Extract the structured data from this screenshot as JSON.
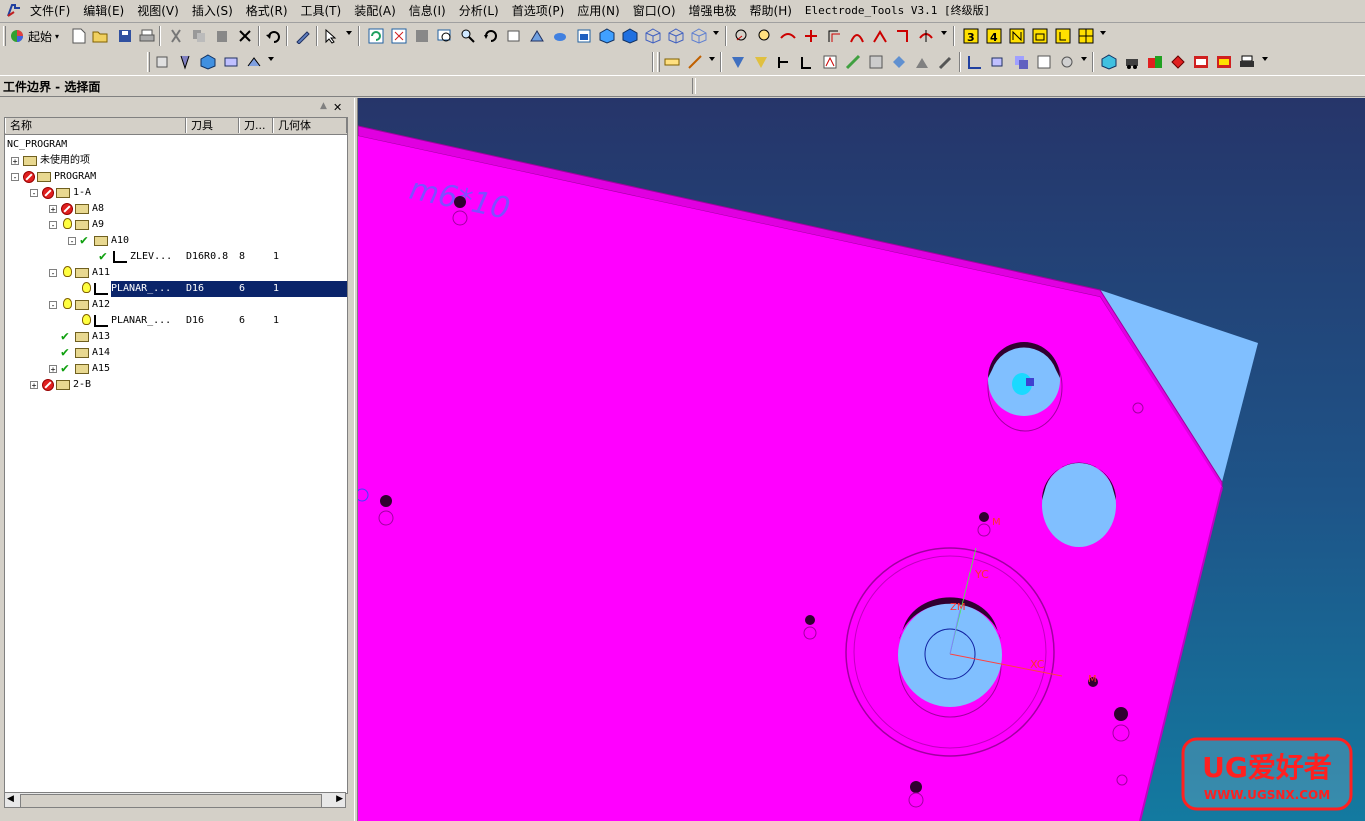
{
  "menubar": {
    "items": [
      "文件(F)",
      "编辑(E)",
      "视图(V)",
      "插入(S)",
      "格式(R)",
      "工具(T)",
      "装配(A)",
      "信息(I)",
      "分析(L)",
      "首选项(P)",
      "应用(N)",
      "窗口(O)",
      "增强电极",
      "帮助(H)",
      "Electrode_Tools V3.1 [终级版]"
    ]
  },
  "toolbar": {
    "start_label": "起始"
  },
  "selection_bar": {
    "label": "工件边界 - 选择面"
  },
  "navigator": {
    "columns": [
      "名称",
      "刀具",
      "刀...",
      "几何体"
    ],
    "rows": [
      {
        "name": "NC_PROGRAM",
        "tool": "",
        "num": "",
        "geom": ""
      },
      {
        "name": "未使用的项",
        "tool": "",
        "num": "",
        "geom": ""
      },
      {
        "name": "PROGRAM",
        "tool": "",
        "num": "",
        "geom": ""
      },
      {
        "name": "1-A",
        "tool": "",
        "num": "",
        "geom": ""
      },
      {
        "name": "A8",
        "tool": "",
        "num": "",
        "geom": ""
      },
      {
        "name": "A9",
        "tool": "",
        "num": "",
        "geom": ""
      },
      {
        "name": "A10",
        "tool": "",
        "num": "",
        "geom": ""
      },
      {
        "name": "ZLEV...",
        "tool": "D16R0.8",
        "num": "8",
        "geom": "1"
      },
      {
        "name": "A11",
        "tool": "",
        "num": "",
        "geom": ""
      },
      {
        "name": "PLANAR_...",
        "tool": "D16",
        "num": "6",
        "geom": "1"
      },
      {
        "name": "A12",
        "tool": "",
        "num": "",
        "geom": ""
      },
      {
        "name": "PLANAR_...",
        "tool": "D16",
        "num": "6",
        "geom": "1"
      },
      {
        "name": "A13",
        "tool": "",
        "num": "",
        "geom": ""
      },
      {
        "name": "A14",
        "tool": "",
        "num": "",
        "geom": ""
      },
      {
        "name": "A15",
        "tool": "",
        "num": "",
        "geom": ""
      },
      {
        "name": "2-B",
        "tool": "",
        "num": "",
        "geom": ""
      }
    ]
  },
  "viewport": {
    "part_annotation": "m6*10",
    "axis_xc": "XC",
    "axis_yc": "YC",
    "axis_zm": "ZM",
    "marker_m1": "M",
    "marker_m2": "M",
    "colors": {
      "part": "#ff00ff",
      "hole": "#80bfff",
      "bg_top": "#26356a",
      "bg_bottom": "#137aa0"
    }
  },
  "watermark": {
    "title": "UG爱好者",
    "url": "WWW.UGSNX.COM"
  }
}
